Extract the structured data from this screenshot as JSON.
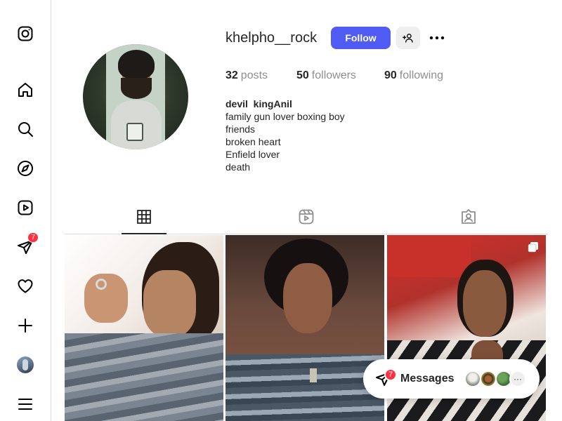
{
  "sidebar": {
    "items": [
      {
        "name": "instagram-logo",
        "label": "Instagram"
      },
      {
        "name": "home",
        "label": "Home"
      },
      {
        "name": "search",
        "label": "Search"
      },
      {
        "name": "explore",
        "label": "Explore"
      },
      {
        "name": "reels",
        "label": "Reels"
      },
      {
        "name": "messages",
        "label": "Messages",
        "badge": "7"
      },
      {
        "name": "notifications",
        "label": "Notifications"
      },
      {
        "name": "create",
        "label": "Create"
      },
      {
        "name": "profile",
        "label": "Profile"
      },
      {
        "name": "more",
        "label": "More"
      }
    ]
  },
  "profile": {
    "username": "khelpho__rock",
    "follow_label": "Follow",
    "stats": {
      "posts_count": "32",
      "posts_label": "posts",
      "followers_count": "50",
      "followers_label": "followers",
      "following_count": "90",
      "following_label": "following"
    },
    "bio": {
      "name": "devil ﻿ king﻿Anil",
      "lines": [
        "family﻿﻿﻿ gun lover ﻿boxing boy﻿﻿",
        "friends﻿﻿",
        "broken heart ﻿",
        "Enfield lover﻿",
        "death ﻿﻿﻿﻿"
      ]
    }
  },
  "tabs": [
    {
      "name": "posts",
      "icon": "grid-icon",
      "active": true
    },
    {
      "name": "reels",
      "icon": "reels-icon",
      "active": false
    },
    {
      "name": "tagged",
      "icon": "tagged-icon",
      "active": false
    }
  ],
  "posts": [
    {
      "kind": "single"
    },
    {
      "kind": "single"
    },
    {
      "kind": "carousel",
      "icon": "multiple-posts-icon"
    }
  ],
  "messages_widget": {
    "label": "Messages",
    "badge": "7",
    "more_glyph": "···"
  },
  "colors": {
    "accent": "#4f5bf2",
    "badge": "#ff3040",
    "border": "#dbdbdb",
    "text": "#262626",
    "muted": "#8e8e8e"
  }
}
